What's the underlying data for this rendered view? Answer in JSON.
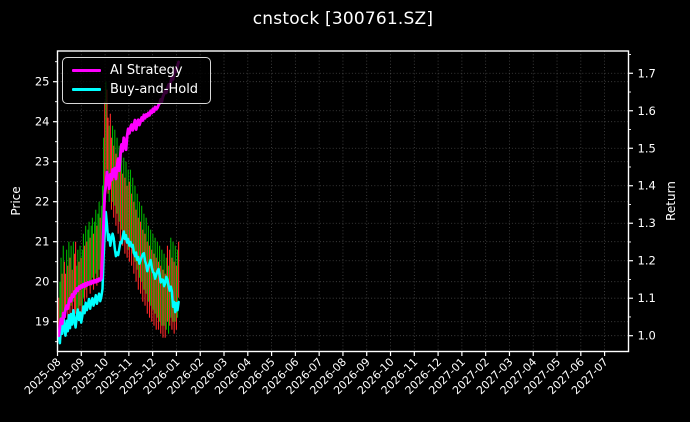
{
  "title": "cnstock [300761.SZ]",
  "legend": {
    "items": [
      {
        "label": "AI Strategy",
        "color": "#ff00ff"
      },
      {
        "label": "Buy-and-Hold",
        "color": "#00ffff"
      }
    ]
  },
  "axes": {
    "left_label": "Price",
    "right_label": "Return"
  },
  "chart_data": {
    "type": "mixed",
    "subtypes": [
      "ohlc-bars",
      "line",
      "line"
    ],
    "title": "cnstock [300761.SZ]",
    "xlabel": "",
    "left_ylabel": "Price",
    "right_ylabel": "Return",
    "grid": true,
    "legend_position": "upper-left",
    "background": "#000000",
    "text_color": "#ffffff",
    "grid_color": "#ffffff",
    "up_color": "#00b300",
    "down_color": "#ff2a2a",
    "x_tick_labels": [
      "2025-08",
      "2025-09",
      "2025-10",
      "2025-11",
      "2025-12",
      "2026-01",
      "2026-02",
      "2026-03",
      "2026-04",
      "2026-05",
      "2026-06",
      "2026-07",
      "2026-08",
      "2026-09",
      "2026-10",
      "2026-11",
      "2026-12",
      "2027-01",
      "2027-02",
      "2027-03",
      "2027-04",
      "2027-05",
      "2027-06",
      "2027-07"
    ],
    "price_ticks": [
      19,
      20,
      21,
      22,
      23,
      24,
      25
    ],
    "return_ticks": [
      1.0,
      1.1,
      1.2,
      1.3,
      1.4,
      1.5,
      1.6,
      1.7
    ],
    "price_axis_range": [
      18.25,
      25.77
    ],
    "return_axis_range": [
      0.958,
      1.759
    ],
    "data_days_span_months": 5.3,
    "candles_note": "daily high-low bars, price axis; u=1 up(green), u=0 down(red)",
    "candles": [
      [
        19.6,
        18.5,
        0
      ],
      [
        20.0,
        18.6,
        1
      ],
      [
        20.6,
        19.0,
        1
      ],
      [
        20.2,
        18.9,
        0
      ],
      [
        20.9,
        19.2,
        1
      ],
      [
        20.5,
        19.0,
        0
      ],
      [
        20.2,
        19.1,
        0
      ],
      [
        20.8,
        19.4,
        1
      ],
      [
        20.4,
        19.0,
        0
      ],
      [
        21.0,
        19.3,
        1
      ],
      [
        20.6,
        19.0,
        0
      ],
      [
        20.9,
        19.4,
        1
      ],
      [
        20.3,
        19.1,
        0
      ],
      [
        21.0,
        19.5,
        1
      ],
      [
        20.7,
        19.2,
        0
      ],
      [
        21.0,
        19.2,
        0
      ],
      [
        20.4,
        19.0,
        1
      ],
      [
        20.8,
        19.3,
        1
      ],
      [
        20.5,
        19.1,
        0
      ],
      [
        20.9,
        19.4,
        1
      ],
      [
        20.6,
        19.2,
        0
      ],
      [
        20.8,
        19.3,
        1
      ],
      [
        21.2,
        19.6,
        1
      ],
      [
        20.9,
        19.5,
        0
      ],
      [
        21.4,
        19.8,
        1
      ],
      [
        21.0,
        19.6,
        0
      ],
      [
        21.3,
        19.9,
        1
      ],
      [
        21.5,
        20.0,
        1
      ],
      [
        21.1,
        19.7,
        0
      ],
      [
        21.4,
        19.9,
        1
      ],
      [
        21.6,
        20.1,
        1
      ],
      [
        21.2,
        19.8,
        0
      ],
      [
        21.5,
        20.0,
        1
      ],
      [
        21.8,
        20.2,
        1
      ],
      [
        21.4,
        19.9,
        0
      ],
      [
        21.7,
        20.1,
        1
      ],
      [
        22.0,
        20.3,
        1
      ],
      [
        21.6,
        20.0,
        0
      ],
      [
        21.9,
        20.2,
        1
      ],
      [
        22.4,
        20.6,
        1
      ],
      [
        23.6,
        21.2,
        1
      ],
      [
        24.5,
        21.6,
        0
      ],
      [
        25.0,
        22.6,
        1
      ],
      [
        24.8,
        22.8,
        0
      ],
      [
        24.1,
        22.2,
        0
      ],
      [
        23.9,
        22.0,
        1
      ],
      [
        24.2,
        22.4,
        0
      ],
      [
        23.6,
        21.8,
        0
      ],
      [
        23.9,
        22.0,
        1
      ],
      [
        23.4,
        21.6,
        0
      ],
      [
        23.8,
        21.9,
        1
      ],
      [
        23.2,
        21.4,
        0
      ],
      [
        23.6,
        21.7,
        1
      ],
      [
        23.0,
        21.2,
        0
      ],
      [
        23.4,
        21.5,
        1
      ],
      [
        22.9,
        21.0,
        0
      ],
      [
        23.3,
        21.3,
        1
      ],
      [
        22.7,
        20.9,
        0
      ],
      [
        23.1,
        21.1,
        1
      ],
      [
        22.6,
        20.7,
        0
      ],
      [
        23.0,
        21.0,
        1
      ],
      [
        22.4,
        20.6,
        0
      ],
      [
        22.8,
        20.8,
        1
      ],
      [
        22.5,
        20.5,
        0
      ],
      [
        22.8,
        20.9,
        1
      ],
      [
        22.2,
        20.4,
        0
      ],
      [
        22.6,
        20.7,
        1
      ],
      [
        22.0,
        20.2,
        0
      ],
      [
        22.4,
        20.5,
        1
      ],
      [
        21.8,
        20.0,
        0
      ],
      [
        22.2,
        20.3,
        1
      ],
      [
        21.6,
        19.8,
        0
      ],
      [
        22.0,
        20.1,
        1
      ],
      [
        21.5,
        19.7,
        0
      ],
      [
        21.9,
        20.0,
        1
      ],
      [
        21.3,
        19.5,
        0
      ],
      [
        21.7,
        19.8,
        1
      ],
      [
        21.2,
        19.4,
        0
      ],
      [
        21.6,
        19.7,
        1
      ],
      [
        21.0,
        19.2,
        0
      ],
      [
        21.4,
        19.5,
        1
      ],
      [
        20.9,
        19.1,
        0
      ],
      [
        21.3,
        19.4,
        1
      ],
      [
        20.8,
        19.0,
        0
      ],
      [
        21.2,
        19.3,
        1
      ],
      [
        20.7,
        18.9,
        0
      ],
      [
        21.1,
        19.2,
        1
      ],
      [
        20.6,
        18.8,
        0
      ],
      [
        21.0,
        19.1,
        1
      ],
      [
        20.5,
        18.8,
        0
      ],
      [
        20.9,
        19.0,
        1
      ],
      [
        20.4,
        18.7,
        0
      ],
      [
        20.8,
        18.9,
        1
      ],
      [
        20.3,
        18.6,
        0
      ],
      [
        20.7,
        18.9,
        1
      ],
      [
        20.2,
        18.6,
        0
      ],
      [
        20.6,
        18.8,
        1
      ],
      [
        20.9,
        19.0,
        0
      ],
      [
        20.4,
        18.7,
        1
      ],
      [
        20.8,
        18.9,
        0
      ],
      [
        21.1,
        19.1,
        1
      ],
      [
        20.6,
        18.8,
        0
      ],
      [
        21.0,
        19.0,
        1
      ],
      [
        20.5,
        18.7,
        0
      ],
      [
        20.9,
        19.0,
        1
      ],
      [
        20.4,
        18.8,
        0
      ],
      [
        20.8,
        19.1,
        1
      ],
      [
        21.0,
        19.6,
        0
      ]
    ],
    "series": [
      {
        "name": "AI Strategy",
        "color": "#ff00ff",
        "axis": "return",
        "values": [
          1.0,
          1.025,
          1.045,
          1.032,
          1.06,
          1.05,
          1.07,
          1.08,
          1.072,
          1.09,
          1.1,
          1.092,
          1.11,
          1.104,
          1.118,
          1.113,
          1.126,
          1.12,
          1.131,
          1.126,
          1.134,
          1.129,
          1.137,
          1.131,
          1.14,
          1.134,
          1.142,
          1.137,
          1.144,
          1.139,
          1.146,
          1.141,
          1.148,
          1.143,
          1.15,
          1.145,
          1.152,
          1.148,
          1.154,
          1.22,
          1.3,
          1.375,
          1.4,
          1.437,
          1.412,
          1.392,
          1.43,
          1.415,
          1.443,
          1.425,
          1.447,
          1.418,
          1.452,
          1.472,
          1.44,
          1.482,
          1.51,
          1.492,
          1.528,
          1.508,
          1.496,
          1.532,
          1.552,
          1.54,
          1.556,
          1.563,
          1.548,
          1.562,
          1.575,
          1.55,
          1.566,
          1.576,
          1.562,
          1.572,
          1.582,
          1.574,
          1.589,
          1.58,
          1.59,
          1.585,
          1.594,
          1.588,
          1.6,
          1.594,
          1.605,
          1.598,
          1.61,
          1.604,
          1.608,
          1.615,
          1.62,
          1.63,
          1.624,
          1.638,
          1.645,
          1.654,
          1.648,
          1.66,
          1.67,
          1.664,
          1.678,
          1.69,
          1.684,
          1.7,
          1.71,
          1.705,
          1.72,
          1.73
        ]
      },
      {
        "name": "Buy-and-Hold",
        "color": "#00ffff",
        "axis": "return",
        "values": [
          1.0,
          0.98,
          1.03,
          1.005,
          1.05,
          1.02,
          1.0,
          1.04,
          1.012,
          1.055,
          1.02,
          1.058,
          1.03,
          1.068,
          1.04,
          1.022,
          1.05,
          1.07,
          1.042,
          1.062,
          1.035,
          1.052,
          1.078,
          1.06,
          1.088,
          1.068,
          1.082,
          1.098,
          1.072,
          1.09,
          1.1,
          1.08,
          1.092,
          1.108,
          1.085,
          1.1,
          1.112,
          1.092,
          1.105,
          1.125,
          1.21,
          1.27,
          1.33,
          1.295,
          1.255,
          1.27,
          1.24,
          1.258,
          1.272,
          1.26,
          1.232,
          1.212,
          1.222,
          1.215,
          1.232,
          1.25,
          1.247,
          1.262,
          1.278,
          1.258,
          1.268,
          1.248,
          1.258,
          1.24,
          1.25,
          1.237,
          1.242,
          1.223,
          1.212,
          1.222,
          1.202,
          1.21,
          1.192,
          1.202,
          1.21,
          1.218,
          1.22,
          1.2,
          1.19,
          1.172,
          1.184,
          1.192,
          1.202,
          1.182,
          1.17,
          1.167,
          1.152,
          1.162,
          1.172,
          1.178,
          1.162,
          1.142,
          1.15,
          1.149,
          1.132,
          1.14,
          1.157,
          1.15,
          1.132,
          1.12,
          1.131,
          1.118,
          1.077,
          1.09,
          1.063,
          1.087,
          1.068,
          1.09
        ]
      }
    ]
  }
}
